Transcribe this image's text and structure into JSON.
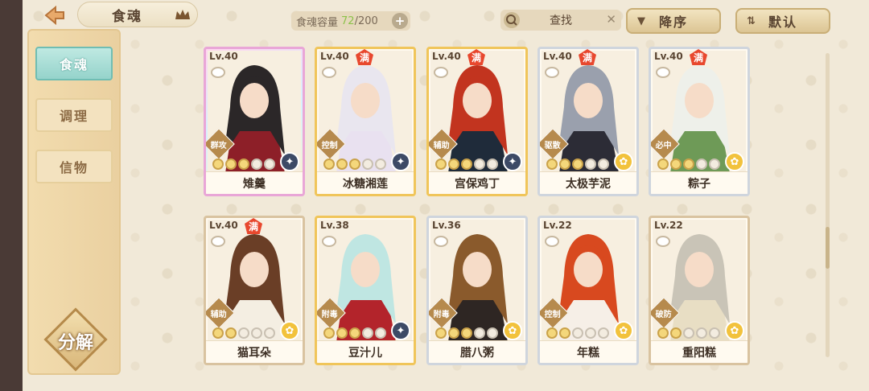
{
  "header": {
    "title": "食魂",
    "capacity_label": "食魂容量",
    "capacity_current": "72",
    "capacity_total": "/200",
    "search_label": "查找",
    "sort_label": "降序",
    "order_label": "默认"
  },
  "sidebar": {
    "items": [
      {
        "label": "食魂",
        "active": true
      },
      {
        "label": "调理",
        "active": false
      },
      {
        "label": "信物",
        "active": false
      }
    ],
    "decompose_label": "分解"
  },
  "cards": [
    {
      "level": "Lv.40",
      "full": false,
      "full_label": "",
      "role": "群攻",
      "stars": 5,
      "stars_on": 3,
      "element": "dark",
      "name": "雉羹",
      "frame": "rare",
      "hair": "#2b2728",
      "cloth": "#8d1f28"
    },
    {
      "level": "Lv.40",
      "full": true,
      "full_label": "满",
      "role": "控制",
      "stars": 5,
      "stars_on": 3,
      "element": "dark",
      "name": "冰糖湘莲",
      "frame": "gold",
      "hair": "#e9e6ef",
      "cloth": "#e9e1f0"
    },
    {
      "level": "Lv.40",
      "full": true,
      "full_label": "满",
      "role": "辅助",
      "stars": 5,
      "stars_on": 3,
      "element": "dark",
      "name": "宫保鸡丁",
      "frame": "gold",
      "hair": "#c2341f",
      "cloth": "#1f2b3a"
    },
    {
      "level": "Lv.40",
      "full": true,
      "full_label": "满",
      "role": "驱散",
      "stars": 5,
      "stars_on": 3,
      "element": "flower",
      "name": "太极芋泥",
      "frame": "silver",
      "hair": "#9aa0ad",
      "cloth": "#2c2c36"
    },
    {
      "level": "Lv.40",
      "full": true,
      "full_label": "满",
      "role": "必中",
      "stars": 5,
      "stars_on": 3,
      "element": "flower",
      "name": "粽子",
      "frame": "silver",
      "hair": "#eef0ea",
      "cloth": "#6e9a57"
    },
    {
      "level": "Lv.40",
      "full": true,
      "full_label": "满",
      "role": "辅助",
      "stars": 5,
      "stars_on": 2,
      "element": "flower",
      "name": "猫耳朵",
      "frame": "bronze",
      "hair": "#6a3e26",
      "cloth": "#f4eee2"
    },
    {
      "level": "Lv.38",
      "full": false,
      "full_label": "",
      "role": "附毒",
      "stars": 5,
      "stars_on": 3,
      "element": "dark",
      "name": "豆汁儿",
      "frame": "gold",
      "hair": "#bfe6e2",
      "cloth": "#b3242b"
    },
    {
      "level": "Lv.36",
      "full": false,
      "full_label": "",
      "role": "附毒",
      "stars": 5,
      "stars_on": 3,
      "element": "flower",
      "name": "腊八粥",
      "frame": "silver",
      "hair": "#8a5a2c",
      "cloth": "#2e2623"
    },
    {
      "level": "Lv.22",
      "full": false,
      "full_label": "",
      "role": "控制",
      "stars": 5,
      "stars_on": 2,
      "element": "flower",
      "name": "年糕",
      "frame": "silver",
      "hair": "#d8491f",
      "cloth": "#f6efe7"
    },
    {
      "level": "Lv.22",
      "full": false,
      "full_label": "",
      "role": "破防",
      "stars": 5,
      "stars_on": 2,
      "element": "flower",
      "name": "重阳糕",
      "frame": "bronze",
      "hair": "#c9c4b7",
      "cloth": "#e8dec4"
    }
  ]
}
